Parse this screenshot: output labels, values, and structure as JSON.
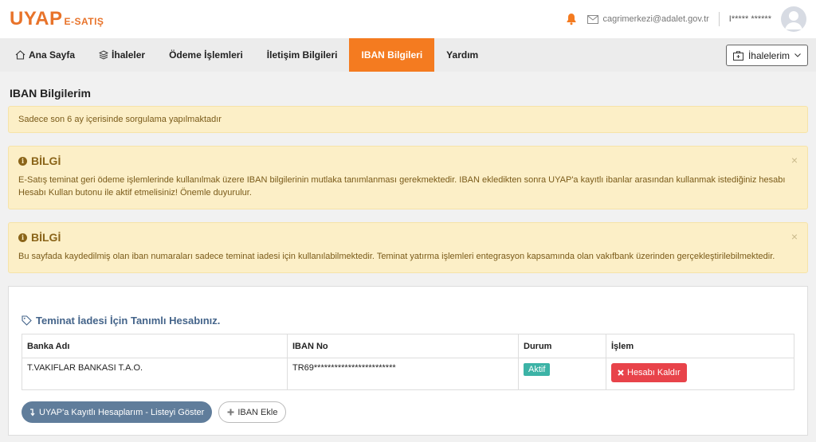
{
  "header": {
    "logo_main": "UYAP",
    "logo_sub": "E-SATIŞ",
    "email": "cagrimerkezi@adalet.gov.tr",
    "user": "I***** ******"
  },
  "nav": {
    "items": [
      {
        "label": "Ana Sayfa",
        "icon": "home-icon"
      },
      {
        "label": "İhaleler",
        "icon": "layers-icon"
      },
      {
        "label": "Ödeme İşlemleri"
      },
      {
        "label": "İletişim Bilgileri"
      },
      {
        "label": "IBAN Bilgileri",
        "active": true
      },
      {
        "label": "Yardım"
      }
    ],
    "ihalelerim_label": "İhalelerim"
  },
  "page": {
    "title": "IBAN Bilgilerim",
    "notice": "Sadece son 6 ay içerisinde sorgulama yapılmaktadır"
  },
  "alerts": [
    {
      "title": "BİLGİ",
      "body": "E-Satış teminat geri ödeme işlemlerinde kullanılmak üzere IBAN bilgilerinin mutlaka tanımlanması gerekmektedir. IBAN ekledikten sonra UYAP'a kayıtlı ibanlar arasından kullanmak istediğiniz hesabı Hesabı Kullan butonu ile aktif etmelisiniz! Önemle duyurulur."
    },
    {
      "title": "BİLGİ",
      "body": "Bu sayfada kaydedilmiş olan iban numaraları sadece teminat iadesi için kullanılabilmektedir. Teminat yatırma işlemleri entegrasyon kapsamında olan vakıfbank üzerinden gerçekleştirilebilmektedir."
    }
  ],
  "panel": {
    "title": "Teminat İadesi İçin Tanımlı Hesabınız.",
    "columns": [
      "Banka Adı",
      "IBAN No",
      "Durum",
      "İşlem"
    ],
    "row": {
      "bank": "T.VAKIFLAR BANKASI T.A.O.",
      "iban": "TR69************************",
      "status": "Aktif",
      "action": "Hesabı Kaldır"
    },
    "list_button": "UYAP'a Kayıtlı Hesaplarım - Listeyi Göster",
    "add_button": "IBAN Ekle"
  },
  "colors": {
    "brand": "#f47b20",
    "alert_bg": "#fcefc7",
    "status_green": "#3cb3a6",
    "danger": "#e8434a"
  }
}
